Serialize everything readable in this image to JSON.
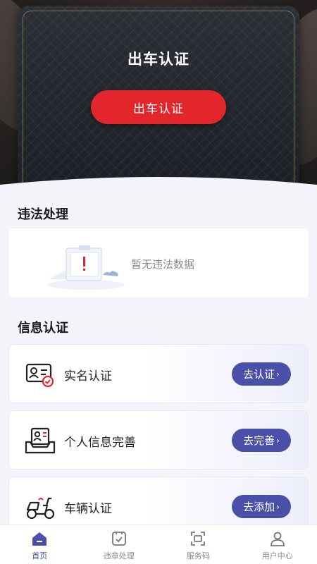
{
  "hero": {
    "title": "出车认证",
    "button_label": "出车认证"
  },
  "violations": {
    "title": "违法处理",
    "empty_text": "暂无违法数据"
  },
  "info": {
    "title": "信息认证",
    "items": [
      {
        "label": "实名认证",
        "action": "去认证",
        "icon": "id-card-icon"
      },
      {
        "label": "个人信息完善",
        "action": "去完善",
        "icon": "profile-tray-icon"
      },
      {
        "label": "车辆认证",
        "action": "去添加",
        "icon": "scooter-icon"
      }
    ]
  },
  "tabs": [
    {
      "label": "首页",
      "icon": "home-icon",
      "active": true
    },
    {
      "label": "违章处理",
      "icon": "violation-check-icon",
      "active": false
    },
    {
      "label": "服务码",
      "icon": "scan-code-icon",
      "active": false
    },
    {
      "label": "用户中心",
      "icon": "user-icon",
      "active": false
    }
  ],
  "colors": {
    "accent": "#4a4fa8",
    "primary_red": "#e3262b",
    "background": "#f4f5fa"
  }
}
